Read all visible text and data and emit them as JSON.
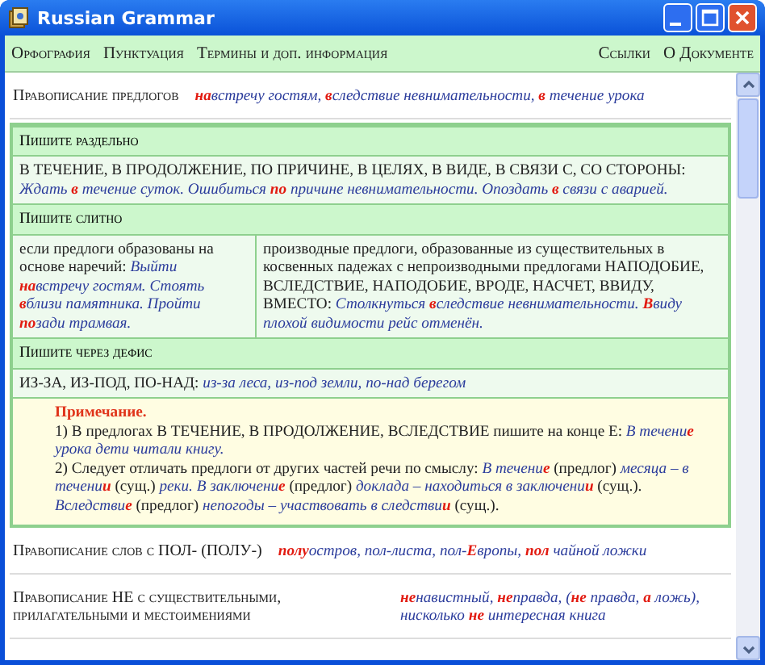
{
  "window": {
    "title": "Russian Grammar"
  },
  "menu_left": [
    "Орфография",
    "Пунктуация",
    "Термины и доп. информация"
  ],
  "menu_right": [
    "Ссылки",
    "О Документе"
  ],
  "blocks": [
    {
      "kind": "topic",
      "heading": "Правописание предлогов",
      "example": [
        {
          "text": "на",
          "kind": "mark"
        },
        {
          "text": "встречу гостям, ",
          "kind": "example"
        },
        {
          "text": "в",
          "kind": "mark"
        },
        {
          "text": "следствие невнимательности, ",
          "kind": "example"
        },
        {
          "text": "в",
          "kind": "mark"
        },
        {
          "text": " течение урока",
          "kind": "example"
        }
      ]
    },
    {
      "kind": "group",
      "items": [
        {
          "kind": "subhead",
          "text": "Пишите раздельно"
        },
        {
          "kind": "row",
          "text": [
            {
              "text": "В ТЕЧЕНИЕ, В ПРОДОЛЖЕНИЕ, ПО ПРИЧИНЕ, В ЦЕЛЯХ, В ВИДЕ, В СВЯЗИ С, СО СТОРОНЫ: ",
              "kind": "plain"
            },
            {
              "text": "Ждать ",
              "kind": "example"
            },
            {
              "text": "в",
              "kind": "mark"
            },
            {
              "text": " течение суток. Ошибиться ",
              "kind": "example"
            },
            {
              "text": "по",
              "kind": "mark"
            },
            {
              "text": " причине невнимательности. Опоздать ",
              "kind": "example"
            },
            {
              "text": "в",
              "kind": "mark"
            },
            {
              "text": " связи с аварией.",
              "kind": "example"
            }
          ]
        },
        {
          "kind": "subhead",
          "text": "Пишите слитно"
        },
        {
          "kind": "split",
          "cells": [
            [
              {
                "text": "если предлоги образованы на основе наречий: ",
                "kind": "plain"
              },
              {
                "text": "Выйти ",
                "kind": "example"
              },
              {
                "text": "на",
                "kind": "mark"
              },
              {
                "text": "встречу гостям. Стоять ",
                "kind": "example"
              },
              {
                "text": "в",
                "kind": "mark"
              },
              {
                "text": "близи памятника. Пройти ",
                "kind": "example"
              },
              {
                "text": "по",
                "kind": "mark"
              },
              {
                "text": "зади трамвая.",
                "kind": "example"
              }
            ],
            [
              {
                "text": "производные предлоги, образованные из существительных в косвенных падежах с непроизводными предлогами НАПОДОБИЕ, ВСЛЕДСТВИЕ, НАПОДОБИЕ, ВРОДЕ, НАСЧЕТ, ВВИДУ, ВМЕСТО: ",
                "kind": "plain"
              },
              {
                "text": "Столкнуться ",
                "kind": "example"
              },
              {
                "text": "в",
                "kind": "mark"
              },
              {
                "text": "следствие невнимательности. ",
                "kind": "example"
              },
              {
                "text": "В",
                "kind": "mark"
              },
              {
                "text": "виду плохой видимости рейс отменён.",
                "kind": "example"
              }
            ]
          ]
        },
        {
          "kind": "subhead",
          "text": "Пишите через дефис"
        },
        {
          "kind": "row",
          "text": [
            {
              "text": "ИЗ-ЗА, ИЗ-ПОД, ПО-НАД: ",
              "kind": "plain"
            },
            {
              "text": "из-за леса, из-под земли, по-над берегом",
              "kind": "example"
            }
          ]
        },
        {
          "kind": "note",
          "title": "Примечание.",
          "paragraphs": [
            [
              {
                "text": "1) В предлогах В ТЕЧЕНИЕ, В ПРОДОЛЖЕНИЕ, ВСЛЕДСТВИЕ пишите на конце Е: ",
                "kind": "plain"
              },
              {
                "text": "В течени",
                "kind": "example"
              },
              {
                "text": "е",
                "kind": "mark"
              },
              {
                "text": " урока дети читали книгу.",
                "kind": "example"
              }
            ],
            [
              {
                "text": "2) Следует отличать предлоги от других частей речи по смыслу: ",
                "kind": "plain"
              },
              {
                "text": "В течени",
                "kind": "example"
              },
              {
                "text": "е",
                "kind": "mark"
              },
              {
                "text": " (предлог) ",
                "kind": "plain"
              },
              {
                "text": "месяца – в течени",
                "kind": "example"
              },
              {
                "text": "и",
                "kind": "mark"
              },
              {
                "text": " (сущ.) ",
                "kind": "plain"
              },
              {
                "text": "реки. В заключени",
                "kind": "example"
              },
              {
                "text": "е",
                "kind": "mark"
              },
              {
                "text": " (предлог) ",
                "kind": "plain"
              },
              {
                "text": "доклада – находиться в заключени",
                "kind": "example"
              },
              {
                "text": "и",
                "kind": "mark"
              },
              {
                "text": " (сущ.). ",
                "kind": "plain"
              },
              {
                "text": "Вследстви",
                "kind": "example"
              },
              {
                "text": "е",
                "kind": "mark"
              },
              {
                "text": " (предлог) ",
                "kind": "plain"
              },
              {
                "text": "непогоды – участвовать в следстви",
                "kind": "example"
              },
              {
                "text": "и",
                "kind": "mark"
              },
              {
                "text": " (сущ.).",
                "kind": "plain"
              }
            ]
          ]
        }
      ]
    },
    {
      "kind": "topic",
      "heading": "Правописание слов с ПОЛ- (ПОЛУ-)",
      "example": [
        {
          "text": "полу",
          "kind": "mark"
        },
        {
          "text": "остров, пол-листа, пол-",
          "kind": "example"
        },
        {
          "text": "Е",
          "kind": "mark"
        },
        {
          "text": "вропы, ",
          "kind": "example"
        },
        {
          "text": "пол",
          "kind": "mark"
        },
        {
          "text": " чайной ложки",
          "kind": "example"
        }
      ]
    },
    {
      "kind": "topic",
      "heading": "Правописание НЕ с существительными, прилагательными и местоимениями",
      "example": [
        {
          "text": "не",
          "kind": "mark"
        },
        {
          "text": "навистный, ",
          "kind": "example"
        },
        {
          "text": "не",
          "kind": "mark"
        },
        {
          "text": "правда, (",
          "kind": "example"
        },
        {
          "text": "не",
          "kind": "mark"
        },
        {
          "text": " правда, ",
          "kind": "example"
        },
        {
          "text": "а",
          "kind": "mark"
        },
        {
          "text": " ложь), нисколько ",
          "kind": "example"
        },
        {
          "text": "не",
          "kind": "mark"
        },
        {
          "text": " интересная книга",
          "kind": "example"
        }
      ]
    }
  ]
}
